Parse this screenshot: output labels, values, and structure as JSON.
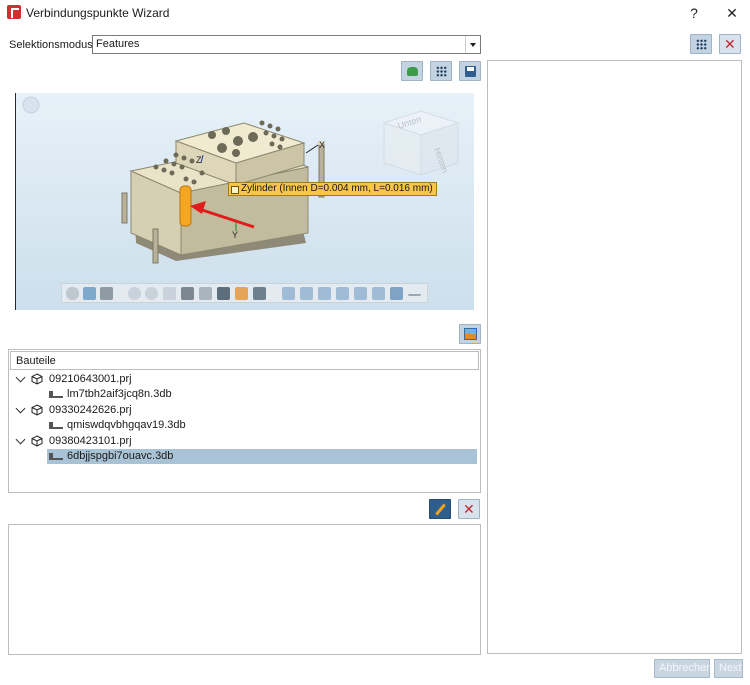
{
  "window": {
    "title": "Verbindungspunkte Wizard",
    "help_label": "?",
    "close_label": "✕"
  },
  "selection": {
    "label": "Selektionsmodus:",
    "value": "Features"
  },
  "viewport": {
    "tooltip": "Zylinder (Innen D=0.004 mm, L=0.016 mm)",
    "viewcube_face_top": "Unten",
    "viewcube_face_side": "Hinten",
    "axis_x": "X",
    "axis_y": "Y",
    "axis_z": "Z"
  },
  "tree": {
    "header": "Bauteile",
    "items": [
      {
        "label": "09210643001.prj",
        "child": "lm7tbh2aif3jcq8n.3db"
      },
      {
        "label": "09330242626.prj",
        "child": "qmiswdqvbhgqav19.3db"
      },
      {
        "label": "09380423101.prj",
        "child": "6dbjjspgbi7ouavc.3db"
      }
    ]
  },
  "buttons": {
    "cancel": "Abbrechen",
    "next": "Next"
  },
  "colors": {
    "accent": "#2e5f8c",
    "selected_row": "#a9c3d6",
    "tooltip_bg": "#f6c54a",
    "delete_red": "#c0282d"
  }
}
